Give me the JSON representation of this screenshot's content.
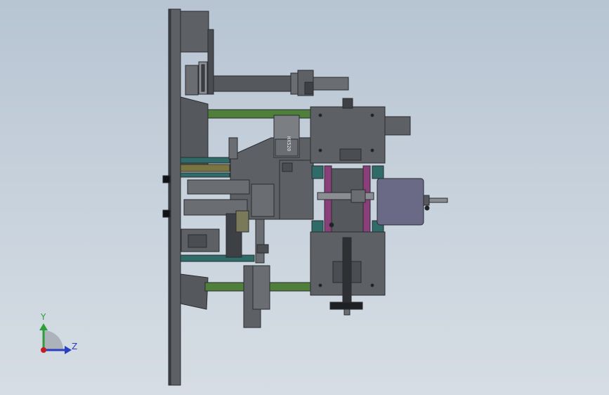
{
  "viewport": {
    "background_top": "#b7c4d2",
    "background_bottom": "#d6dde4"
  },
  "model": {
    "plate_label": "HX520",
    "colors": {
      "steel": "#5d6065",
      "steel_dark": "#3d4045",
      "steel_light": "#8a8d92",
      "green": "#4f7f3a",
      "teal": "#2f6b68",
      "magenta": "#8a3f7a",
      "motor": "#6a6a86",
      "gold": "#7a7440",
      "outline": "#2a2c30"
    }
  },
  "triad": {
    "y_label": "Y",
    "z_label": "Z",
    "y_color": "#2e9e3a",
    "z_color": "#2a3fc0",
    "origin_color": "#c02020"
  }
}
